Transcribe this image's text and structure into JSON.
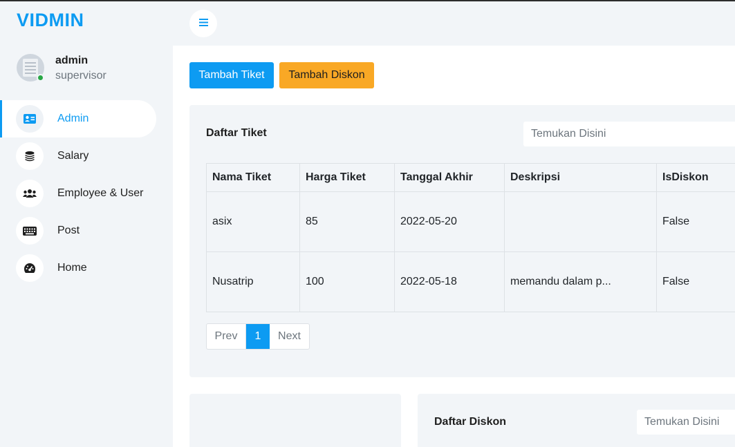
{
  "brand": "VIDMIN",
  "profile": {
    "name": "admin",
    "role": "supervisor"
  },
  "menu": [
    {
      "label": "Admin",
      "icon": "id-card-icon"
    },
    {
      "label": "Salary",
      "icon": "coins-icon"
    },
    {
      "label": "Employee & User",
      "icon": "users-icon"
    },
    {
      "label": "Post",
      "icon": "keyboard-icon"
    },
    {
      "label": "Home",
      "icon": "gauge-icon"
    }
  ],
  "actions": {
    "tambah_tiket": "Tambah Tiket",
    "tambah_diskon": "Tambah Diskon"
  },
  "tiket": {
    "title": "Daftar Tiket",
    "search_placeholder": "Temukan Disini",
    "columns": [
      "Nama Tiket",
      "Harga Tiket",
      "Tanggal Akhir",
      "Deskripsi",
      "IsDiskon"
    ],
    "rows": [
      [
        "asix",
        "85",
        "2022-05-20",
        "",
        "False"
      ],
      [
        "Nusatrip",
        "100",
        "2022-05-18",
        "memandu dalam p...",
        "False"
      ]
    ],
    "pagination": {
      "prev": "Prev",
      "current": "1",
      "next": "Next"
    }
  },
  "diskon": {
    "title": "Daftar Diskon",
    "search_placeholder": "Temukan Disini"
  },
  "colors": {
    "accent": "#0d9bf2",
    "warning": "#f9a825",
    "panel": "#f2f5f8",
    "online": "#28a745"
  }
}
